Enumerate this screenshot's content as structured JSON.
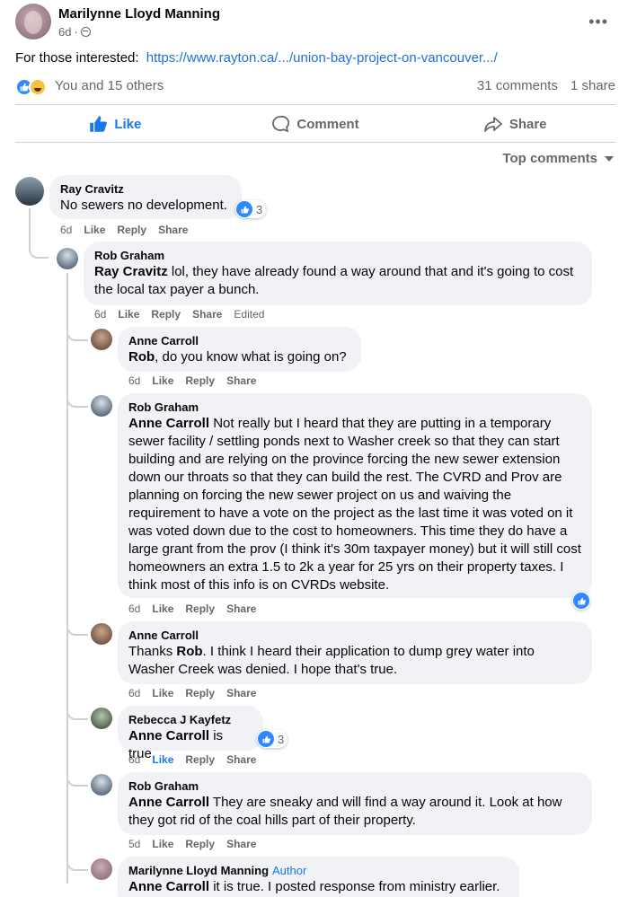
{
  "post": {
    "author": "Marilynne Lloyd Manning",
    "time": "6d",
    "dot": "·",
    "text": "For those interested:",
    "link": "https://www.rayton.ca/.../union-bay-project-on-vancouver.../",
    "reaction_summary": "You and 15 others",
    "comments_count": "31 comments",
    "shares_count": "1 share"
  },
  "actions": {
    "like": "Like",
    "comment": "Comment",
    "share": "Share"
  },
  "sort_label": "Top comments",
  "comment_actions": {
    "like": "Like",
    "reply": "Reply",
    "share": "Share",
    "edited": "Edited"
  },
  "author_badge": "Author",
  "comments": [
    {
      "name": "Ray Cravitz",
      "mention": "",
      "text": "No sewers no development.",
      "time": "6d",
      "reactions": "3"
    },
    {
      "name": "Rob Graham",
      "mention": "Ray Cravitz",
      "text": "lol, they have already found a way around that and it's going to cost the local tax payer a bunch.",
      "time": "6d"
    },
    {
      "name": "Anne Carroll",
      "mention": "Rob",
      "text": ", do you know what is going on?",
      "time": "6d"
    },
    {
      "name": "Rob Graham",
      "mention": "Anne Carroll",
      "text": "Not really but I heard that they are putting in a temporary sewer facility / settling ponds next to Washer creek so that they can start building and are relying on the province forcing the new sewer extension down our throats so that they can build the rest. The CVRD and Prov are planning on forcing the new sewer project on us and waiving the requirement to have a vote on the project as the last time it was voted on it was voted down due to the cost to homeowners. This time they do have a large grant from the prov (I think it's 30m taxpayer money) but it will still cost homeowners an extra 1.5 to 2k a year for 25 yrs on their property taxes. I think most of this info is on CVRDs website.",
      "time": "6d"
    },
    {
      "name": "Anne Carroll",
      "prefix": "Thanks ",
      "mention": "Rob",
      "text": ". I think I heard their application to dump grey water into Washer Creek was denied. I hope that's true.",
      "time": "6d"
    },
    {
      "name": "Rebecca J Kayfetz",
      "mention": "Anne Carroll",
      "text": "is true.",
      "time": "6d",
      "reactions": "3"
    },
    {
      "name": "Rob Graham",
      "mention": "Anne Carroll",
      "text": "They are sneaky and will find a way around it. Look at how they got rid of the coal hills part of their property.",
      "time": "5d"
    },
    {
      "name": "Marilynne Lloyd Manning",
      "mention": "Anne Carroll",
      "text": "it is true. I posted response from ministry earlier."
    }
  ],
  "colors": {
    "accent": "#1877f2",
    "bubble": "#f0f2f5",
    "muted": "#65676b"
  }
}
